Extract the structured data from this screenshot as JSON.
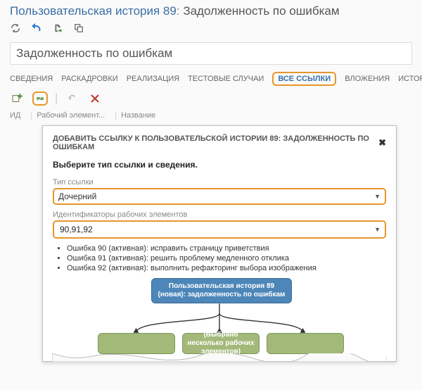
{
  "header": {
    "link": "Пользовательская история 89",
    "sep": ":",
    "title": "Задолженность по ошибкам"
  },
  "title_input": {
    "value": "Задолженность по ошибкам"
  },
  "tabs": {
    "items": [
      {
        "key": "details",
        "label": "СВЕДЕНИЯ"
      },
      {
        "key": "storyboards",
        "label": "РАСКАДРОВКИ"
      },
      {
        "key": "implementation",
        "label": "РЕАЛИЗАЦИЯ"
      },
      {
        "key": "testcases",
        "label": "ТЕСТОВЫЕ СЛУЧАИ"
      },
      {
        "key": "alllinks",
        "label": "ВСЕ ССЫЛКИ"
      },
      {
        "key": "attachments",
        "label": "ВЛОЖЕНИЯ"
      },
      {
        "key": "history",
        "label": "ИСТОРИЯ"
      }
    ],
    "active": "alllinks"
  },
  "list_columns": {
    "id": "ИД",
    "workitem": "Рабочий элемент...",
    "name": "Название"
  },
  "dialog": {
    "title": "ДОБАВИТЬ ССЫЛКУ К ПОЛЬЗОВАТЕЛЬСКОЙ ИСТОРИИ 89: ЗАДОЛЖЕННОСТЬ ПО ОШИБКАМ",
    "close": "✖",
    "subtitle": "Выберите тип ссылки и сведения.",
    "link_type_label": "Тип ссылки",
    "link_type_value": "Дочерний",
    "ids_label": "Идентификаторы рабочих элементов",
    "ids_value": "90,91,92",
    "bullets": [
      "Ошибка 90 (активная): исправить страницу приветствия",
      "Ошибка 91 (активная): решить проблему медленного отклика",
      "Ошибка 92 (активная): выполнить рефакторинг выбора изображения"
    ],
    "diagram": {
      "parent": "Пользовательская история 89 (новая): задолженность по ошибкам",
      "child_selected": "(Выбрано несколько рабочих элементов)"
    }
  }
}
